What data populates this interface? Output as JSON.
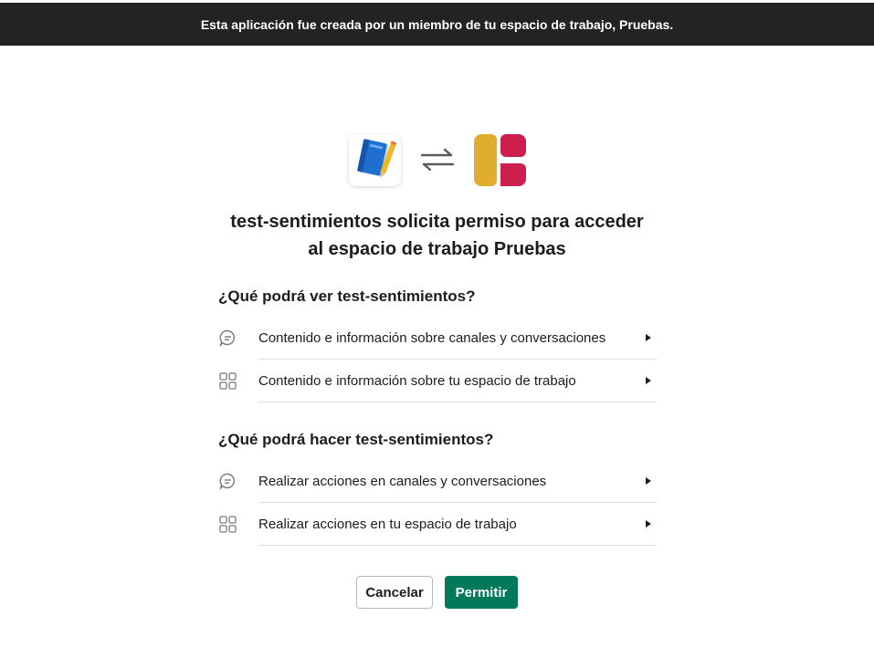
{
  "banner": {
    "text": "Esta aplicación fue creada por un miembro de tu espacio de trabajo, Pruebas."
  },
  "apps": {
    "left_icon": "notebook-app-icon",
    "swap_icon": "swap-arrows-icon",
    "right_icon": "workspace-logo-icon"
  },
  "title": {
    "line1": "test-sentimientos solicita permiso para acceder",
    "line2": "al espacio de trabajo Pruebas"
  },
  "view_section": {
    "heading": "¿Qué podrá ver test-sentimientos?",
    "items": [
      {
        "icon": "chat-bubble-icon",
        "label": "Contenido e información sobre canales y conversaciones"
      },
      {
        "icon": "grid-icon",
        "label": "Contenido e información sobre tu espacio de trabajo"
      }
    ]
  },
  "do_section": {
    "heading": "¿Qué podrá hacer test-sentimientos?",
    "items": [
      {
        "icon": "chat-bubble-icon",
        "label": "Realizar acciones en canales y conversaciones"
      },
      {
        "icon": "grid-icon",
        "label": "Realizar acciones en tu espacio de trabajo"
      }
    ]
  },
  "actions": {
    "cancel_label": "Cancelar",
    "allow_label": "Permitir"
  },
  "colors": {
    "banner_bg": "#232323",
    "allow_button": "#007a5a",
    "logo_yellow": "#e0ad2e",
    "logo_red": "#cc1f4f"
  }
}
